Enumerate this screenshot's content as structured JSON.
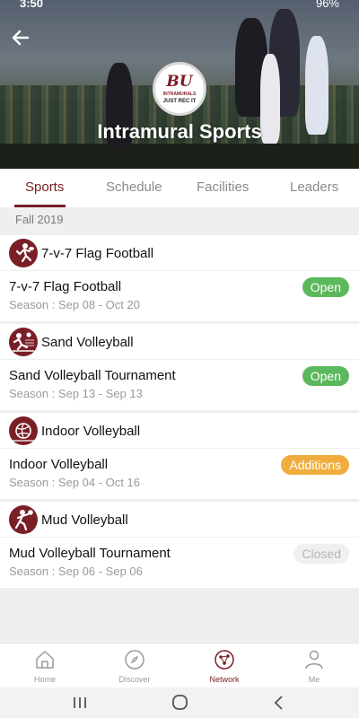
{
  "status_bar": {
    "time": "3:50",
    "battery": "96%"
  },
  "header": {
    "title": "Intramural Sports",
    "logo_text": "BU",
    "logo_subtext": "INTRAMURALS",
    "logo_tagline": "JUST REC IT"
  },
  "tabs": [
    {
      "label": "Sports",
      "active": true
    },
    {
      "label": "Schedule",
      "active": false
    },
    {
      "label": "Facilities",
      "active": false
    },
    {
      "label": "Leaders",
      "active": false
    }
  ],
  "term": "Fall 2019",
  "sports": [
    {
      "category": "7-v-7 Flag Football",
      "icon": "flag-football-icon",
      "league": "7-v-7 Flag Football",
      "season": "Season : Sep 08 - Oct 20",
      "status": "Open"
    },
    {
      "category": "Sand Volleyball",
      "icon": "sand-volleyball-icon",
      "league": "Sand Volleyball Tournament",
      "season": "Season : Sep 13 - Sep 13",
      "status": "Open"
    },
    {
      "category": "Indoor Volleyball",
      "icon": "indoor-volleyball-icon",
      "league": "Indoor Volleyball",
      "season": "Season : Sep 04 - Oct 16",
      "status": "Additions"
    },
    {
      "category": "Mud Volleyball",
      "icon": "mud-volleyball-icon",
      "league": "Mud Volleyball Tournament",
      "season": "Season : Sep 06 - Sep 06",
      "status": "Closed"
    }
  ],
  "bottom_nav": [
    {
      "label": "Home",
      "icon": "home-icon",
      "active": false
    },
    {
      "label": "Discover",
      "icon": "compass-icon",
      "active": false
    },
    {
      "label": "Network",
      "icon": "network-icon",
      "active": true
    },
    {
      "label": "Me",
      "icon": "person-icon",
      "active": false
    }
  ],
  "colors": {
    "brand": "#7a1f27",
    "open": "#5cb85c",
    "additions": "#f0ad3e",
    "closed": "#f0f0f0"
  }
}
